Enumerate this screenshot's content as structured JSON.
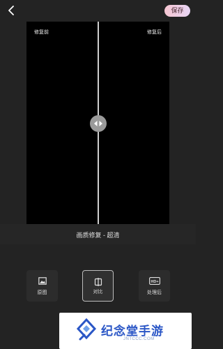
{
  "header": {
    "save_label": "保存"
  },
  "compare": {
    "before_label": "修复前",
    "after_label": "修复后"
  },
  "caption": "画质修复 - 超清",
  "tools": [
    {
      "label": "原图",
      "icon": "image-icon"
    },
    {
      "label": "对比",
      "icon": "compare-icon"
    },
    {
      "label": "处理后",
      "icon": "hd-icon",
      "badge": "HD+"
    }
  ],
  "watermark": {
    "title": "纪念堂手游",
    "subtitle": "JNTCCC.COM"
  },
  "colors": {
    "background": "#232323",
    "save_gradient_start": "#f6c6d2",
    "save_gradient_end": "#e7d4f4",
    "brand": "#2a56c6"
  }
}
